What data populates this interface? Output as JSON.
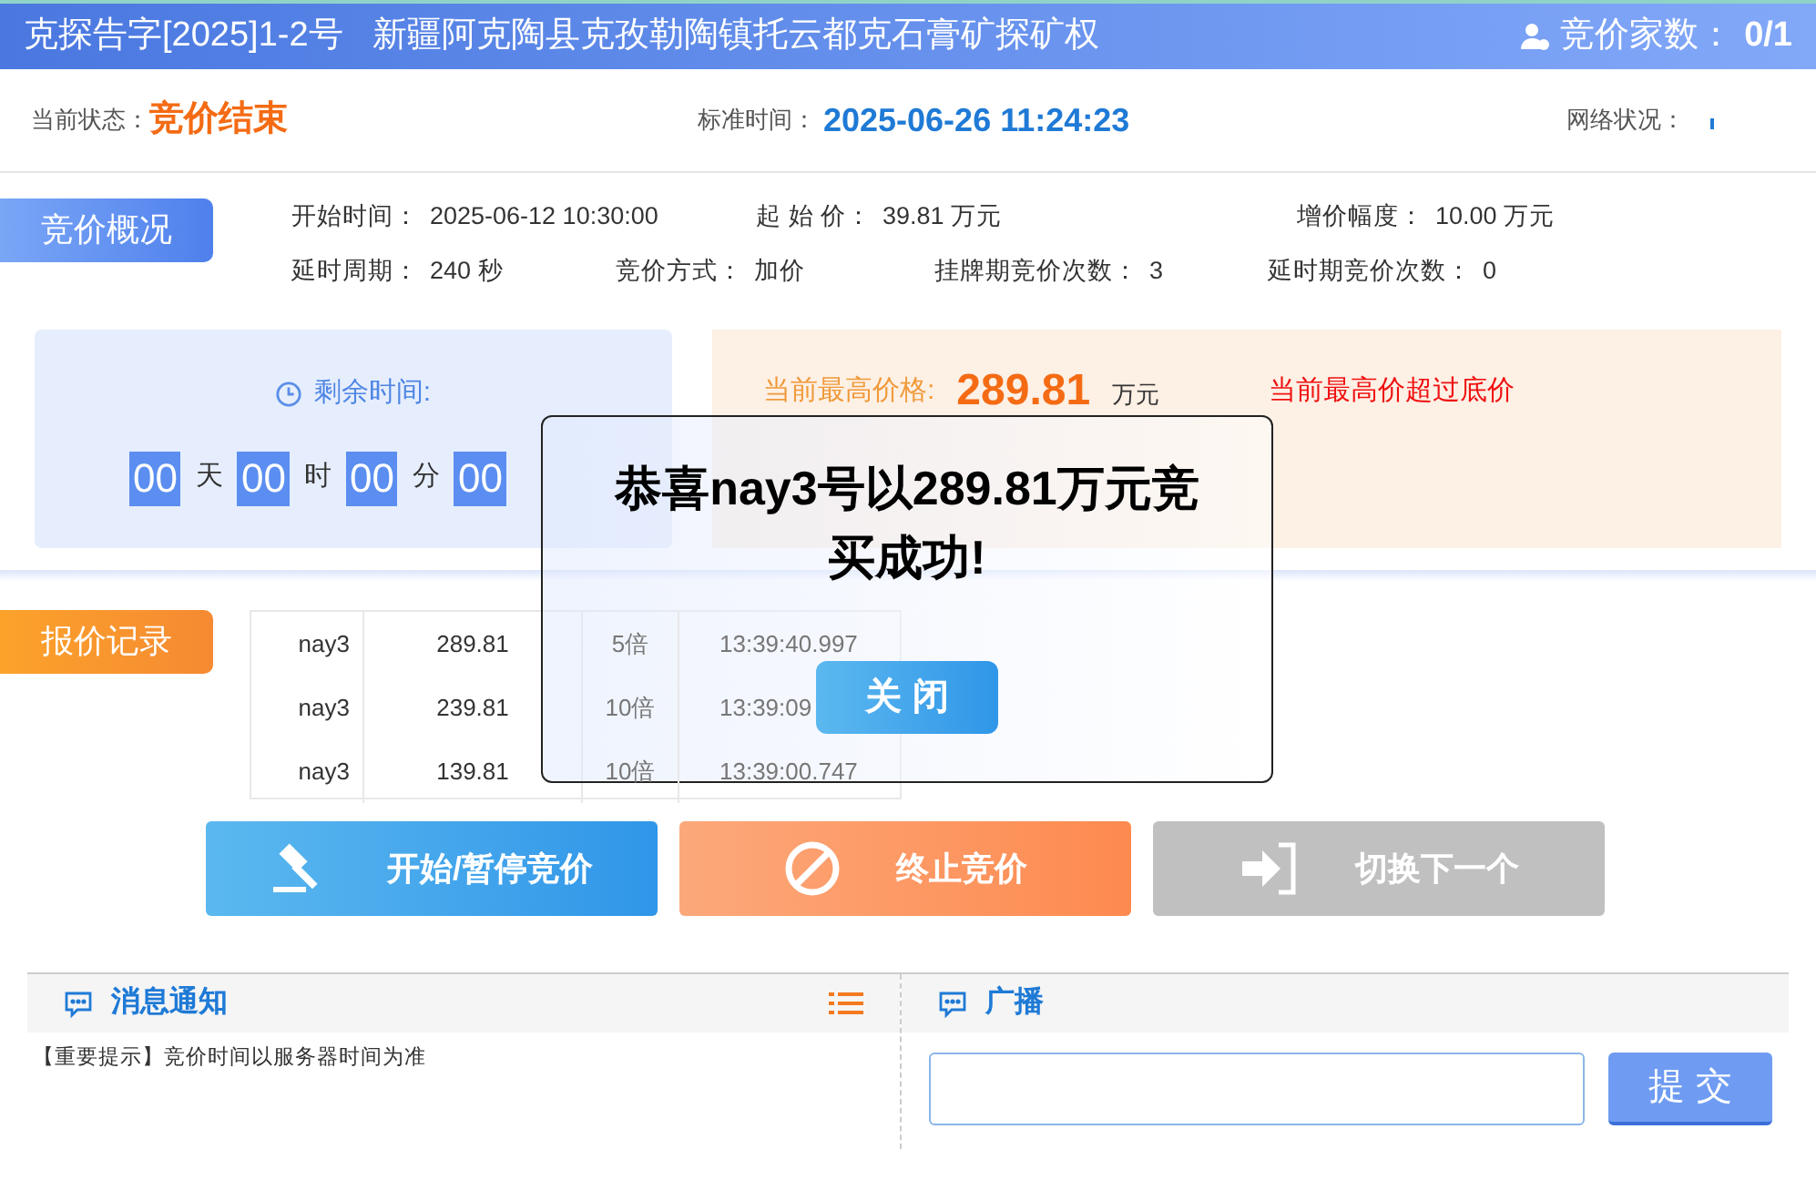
{
  "header": {
    "title": "克探告字[2025]1-2号",
    "subtitle": "新疆阿克陶县克孜勒陶镇托云都克石膏矿探矿权",
    "bidders_label": "竞价家数：",
    "bidders_value": "0/1"
  },
  "status": {
    "state_label": "当前状态：",
    "state": "竞价结束",
    "time_label": "标准时间：",
    "time": "2025-06-26 11:24:23",
    "network_label": "网络状况："
  },
  "overview": {
    "tag": "竞价概况",
    "rows": [
      [
        {
          "label": "开始时间：",
          "value": "2025-06-12 10:30:00"
        },
        {
          "label": "起 始 价：",
          "value": "39.81 万元"
        },
        "",
        {
          "label": "增价幅度：",
          "value": "10.00 万元"
        }
      ],
      [
        {
          "label": "延时周期：",
          "value": "240 秒"
        },
        {
          "label": "竞价方式：",
          "value": "加价"
        },
        {
          "label": "挂牌期竞价次数：",
          "value": "3"
        },
        {
          "label": "延时期竞价次数：",
          "value": "0"
        }
      ]
    ]
  },
  "countdown": {
    "label": "剩余时间:",
    "parts": [
      {
        "value": "00",
        "unit": "天"
      },
      {
        "value": "00",
        "unit": "时"
      },
      {
        "value": "00",
        "unit": "分"
      },
      {
        "value": "00"
      }
    ]
  },
  "price": {
    "label": "当前最高价格:",
    "value": "289.81",
    "unit": "万元",
    "note": "当前最高价超过底价"
  },
  "records": {
    "tag": "报价记录",
    "rows": [
      {
        "bidder": "nay3",
        "price": "289.81",
        "multiple": "5倍",
        "time": "13:39:40.997"
      },
      {
        "bidder": "nay3",
        "price": "239.81",
        "multiple": "10倍",
        "time": "13:39:09"
      },
      {
        "bidder": "nay3",
        "price": "139.81",
        "multiple": "10倍",
        "time": "13:39:00.747"
      }
    ]
  },
  "actions": [
    {
      "kind": "gavel",
      "label": "开始/暂停竞价"
    },
    {
      "kind": "stop",
      "label": "终止竞价"
    },
    {
      "kind": "next",
      "label": "切换下一个"
    }
  ],
  "messages": {
    "title": "消息通知",
    "items": [
      "【重要提示】竞价时间以服务器时间为准"
    ]
  },
  "broadcast": {
    "title": "广播",
    "submit": "提 交"
  },
  "modal": {
    "message": "恭喜nay3号以289.81万元竞买成功!",
    "close": "关 闭"
  }
}
